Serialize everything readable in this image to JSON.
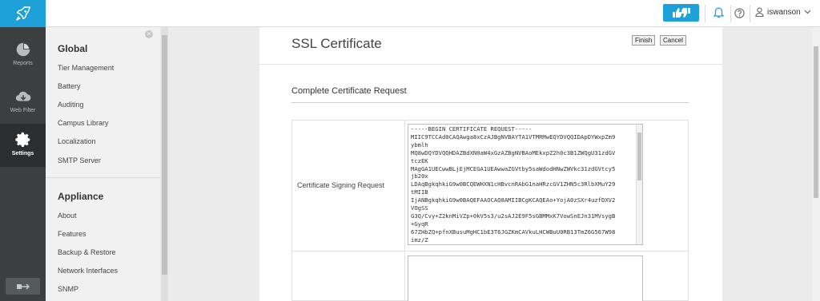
{
  "rail": {
    "items": [
      {
        "label": "Reports",
        "icon": "pie-chart-icon"
      },
      {
        "label": "Web Filter",
        "icon": "cloud-icon"
      },
      {
        "label": "Settings",
        "icon": "gear-icon"
      }
    ]
  },
  "topbar": {
    "username": "iswanson"
  },
  "sidebar": {
    "global_heading": "Global",
    "global_items": [
      "Tier Management",
      "Battery",
      "Auditing",
      "Campus Library",
      "Localization",
      "SMTP Server"
    ],
    "appliance_heading": "Appliance",
    "appliance_items": [
      "About",
      "Features",
      "Backup & Restore",
      "Network Interfaces",
      "SNMP"
    ]
  },
  "main": {
    "title": "SSL Certificate",
    "finish_label": "Finish",
    "cancel_label": "Cancel",
    "section_title": "Complete Certificate Request",
    "csr_label": "Certificate Signing Request",
    "csr_value": "-----BEGIN CERTIFICATE REQUEST-----\nMIIC9TCCAd0CAQAwga8xCzAJBgNVBAYTA1VTMRMwEQYDVQQIDApDYWxpZm9\nybmlh\nMQ8wDQYDVQQHDAZBdXN0aW4xGzAZBgNVBAoMEkxpZ2h0c3B1ZWQgU31zdGV\ntczEK\nMAgGA1UECwwBLjEjMCEGA1UEAwwaZGVtby5saWdodHNwZWVkc31zdGVtcy5\njb20x\nLDAqBgkqhkiG9w0BCQEWHXN1cHBvcnRAbG1naHRzcGV1ZHN5c3RlbXMuY29\ntMIIB\nIjANBgkqhkiG9w0BAQEFAAOCAQ8AMIIBCgKCAQEAo+YojA0zSXr4uzfDXV2\nVOgSS\nG3Q/Cvy+Z2knMiVZp+0kV5s3/u2sAJ2E9F5sGBMMxK7VowSnEJn31MVsygB\n+GyqR\n67ZHbZQ+pfnXBusuMgHC1bE3T6JGZKmCAVkuLHCWBuU0RB13TmZ6G567W98\nimz/Z"
  },
  "colors": {
    "accent": "#1ea0d8",
    "rail_bg": "#3b3f40"
  }
}
